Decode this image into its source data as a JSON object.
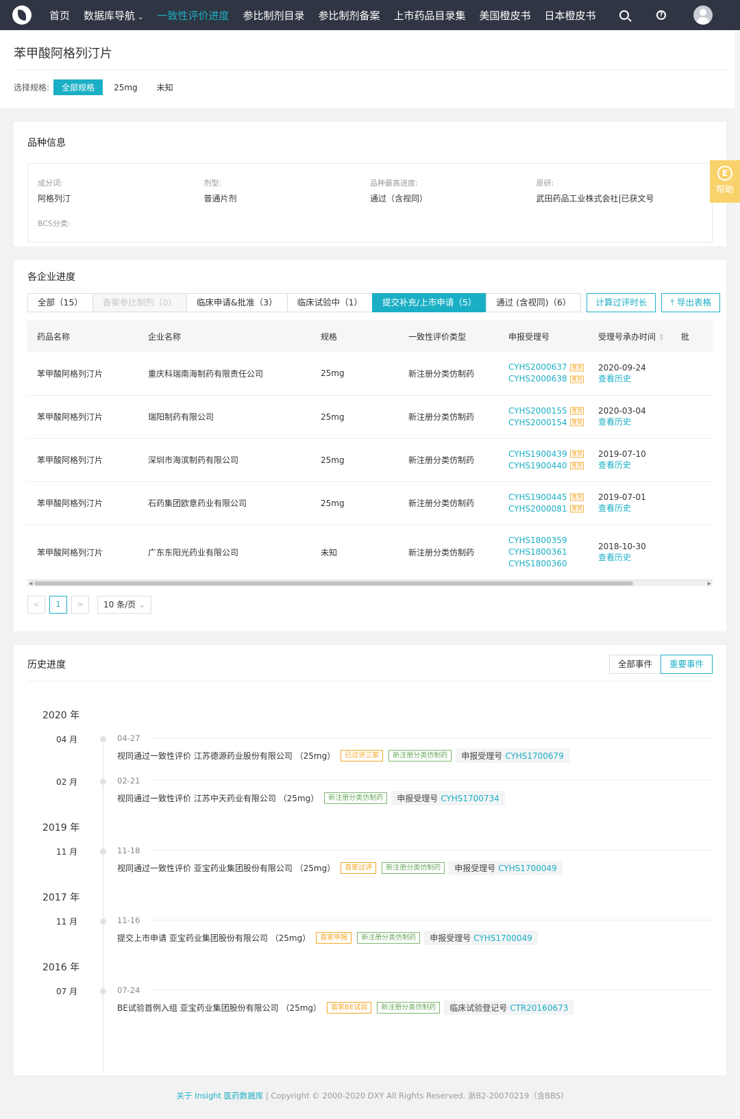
{
  "nav": {
    "items": [
      {
        "label": "首页"
      },
      {
        "label": "数据库导航",
        "caret": "⌄"
      },
      {
        "label": "一致性评价进度",
        "active": true
      },
      {
        "label": "参比制剂目录"
      },
      {
        "label": "参比制剂备案"
      },
      {
        "label": "上市药品目录集"
      },
      {
        "label": "美国橙皮书"
      },
      {
        "label": "日本橙皮书"
      }
    ],
    "help_glyph": "?"
  },
  "page": {
    "title": "苯甲酸阿格列汀片",
    "spec_label": "选择规格:",
    "specs": [
      "全部规格",
      "25mg",
      "未知"
    ]
  },
  "info": {
    "title": "品种信息",
    "fields": [
      {
        "label": "成分词:",
        "value": "阿格列汀"
      },
      {
        "label": "剂型:",
        "value": "普通片剂"
      },
      {
        "label": "品种最高进度:",
        "value": "通过（含视同）"
      },
      {
        "label": "原研:",
        "value": "武田药品工业株式会社|已获文号"
      }
    ],
    "bcs_label": "BCS分类:"
  },
  "progress": {
    "title": "各企业进度",
    "tabs": [
      "全部（15）",
      "备案参比制剂（0）",
      "临床申请&批准（3）",
      "临床试验中（1）",
      "提交补充/上市申请（5）",
      "通过 (含视同)（6）"
    ],
    "buttons": {
      "calc": "计算过评时长",
      "export": "导出表格"
    },
    "export_icon": "⤒",
    "columns": [
      "药品名称",
      "企业名称",
      "规格",
      "一致性评价类型",
      "申报受理号",
      "受理号承办时间",
      "批"
    ],
    "sort_icon": "⇕",
    "tui_tag": "推测",
    "rows": [
      {
        "drug": "苯甲酸阿格列汀片",
        "company": "重庆科瑞南海制药有限责任公司",
        "spec": "25mg",
        "type": "新注册分类仿制药",
        "acc": [
          "CYHS2000637",
          "CYHS2000638"
        ],
        "date": "2020-09-24",
        "hist": "查看历史"
      },
      {
        "drug": "苯甲酸阿格列汀片",
        "company": "瑞阳制药有限公司",
        "spec": "25mg",
        "type": "新注册分类仿制药",
        "acc": [
          "CYHS2000155",
          "CYHS2000154"
        ],
        "date": "2020-03-04",
        "hist": "查看历史"
      },
      {
        "drug": "苯甲酸阿格列汀片",
        "company": "深圳市海滨制药有限公司",
        "spec": "25mg",
        "type": "新注册分类仿制药",
        "acc": [
          "CYHS1900439",
          "CYHS1900440"
        ],
        "date": "2019-07-10",
        "hist": "查看历史"
      },
      {
        "drug": "苯甲酸阿格列汀片",
        "company": "石药集团欧意药业有限公司",
        "spec": "25mg",
        "type": "新注册分类仿制药",
        "acc": [
          "CYHS1900445",
          "CYHS2000081"
        ],
        "date": "2019-07-01",
        "hist": "查看历史"
      },
      {
        "drug": "苯甲酸阿格列汀片",
        "company": "广东东阳光药业有限公司",
        "spec": "未知",
        "type": "新注册分类仿制药",
        "acc": [
          "CYHS1800359",
          "CYHS1800361",
          "CYHS1800360"
        ],
        "date": "2018-10-30",
        "hist": "查看历史"
      }
    ],
    "pager": {
      "prev": "<",
      "page": "1",
      "next": ">",
      "size": "10 条/页",
      "size_caret": "⌄"
    }
  },
  "history": {
    "title": "历史进度",
    "seg": [
      "全部事件",
      "重要事件"
    ],
    "years": [
      {
        "year": "2020 年",
        "events": [
          {
            "month": "04 月",
            "date": "04-27",
            "text": "视同通过一致性评价 江苏德源药业股份有限公司 （25mg）",
            "tags": [
              {
                "t": "已过评三家",
                "c": "o"
              },
              {
                "t": "新注册分类仿制药",
                "c": "g"
              }
            ],
            "reg_label": "申报受理号",
            "reg": "CYHS1700679"
          },
          {
            "month": "02 月",
            "date": "02-21",
            "text": "视同通过一致性评价 江苏中天药业有限公司 （25mg）",
            "tags": [
              {
                "t": "新注册分类仿制药",
                "c": "g"
              }
            ],
            "reg_label": "申报受理号",
            "reg": "CYHS1700734"
          }
        ]
      },
      {
        "year": "2019 年",
        "events": [
          {
            "month": "11 月",
            "date": "11-18",
            "text": "视同通过一致性评价 亚宝药业集团股份有限公司 （25mg）",
            "tags": [
              {
                "t": "首家过评",
                "c": "o"
              },
              {
                "t": "新注册分类仿制药",
                "c": "g"
              }
            ],
            "reg_label": "申报受理号",
            "reg": "CYHS1700049"
          }
        ]
      },
      {
        "year": "2017 年",
        "events": [
          {
            "month": "11 月",
            "date": "11-16",
            "text": "提交上市申请 亚宝药业集团股份有限公司 （25mg）",
            "tags": [
              {
                "t": "首家申报",
                "c": "o"
              },
              {
                "t": "新注册分类仿制药",
                "c": "g"
              }
            ],
            "reg_label": "申报受理号",
            "reg": "CYHS1700049"
          }
        ]
      },
      {
        "year": "2016 年",
        "events": [
          {
            "month": "07 月",
            "date": "07-24",
            "text": "BE试验首例入组 亚宝药业集团股份有限公司 （25mg）",
            "tags": [
              {
                "t": "首家BE试验",
                "c": "o"
              },
              {
                "t": "新注册分类仿制药",
                "c": "g"
              }
            ],
            "reg_label": "临床试验登记号",
            "reg": "CTR20160673"
          }
        ]
      }
    ]
  },
  "help": {
    "label": "帮助",
    "glyph": "E"
  },
  "footer": {
    "about": "关于 Insight 医药数据库",
    "sep": " | ",
    "copyright": "Copyright © 2000-2020 DXY All Rights Reserved. 浙B2-20070219（含BBS)"
  }
}
